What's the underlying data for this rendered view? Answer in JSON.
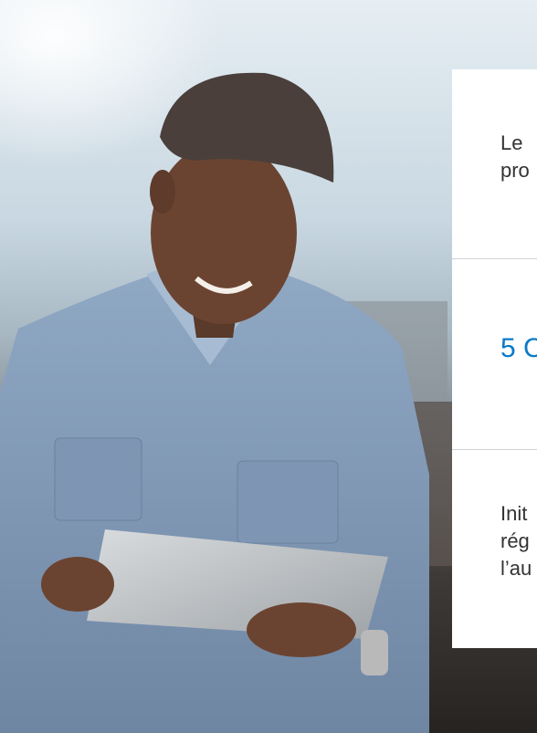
{
  "cards": [
    {
      "lines": [
        "Le",
        "pro"
      ]
    },
    {
      "lines": [
        "5 C"
      ]
    },
    {
      "lines": [
        "Init",
        "rég",
        "l’au"
      ]
    }
  ],
  "colors": {
    "accent": "#0a79c8",
    "text": "#333333",
    "divider": "#cfd3d6"
  }
}
